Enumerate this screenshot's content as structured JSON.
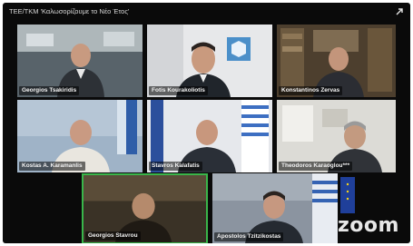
{
  "window": {
    "title": "ΤΕΕ/ΤΚΜ 'Καλωσορίζουμε το Νέο Έτος'"
  },
  "participants": [
    {
      "name": "Georgios Tsakiridis",
      "speaking": false
    },
    {
      "name": "Fotis Kourakoliotis",
      "speaking": false
    },
    {
      "name": "Konstantinos Zervas",
      "speaking": false
    },
    {
      "name": "Kostas A. Karamanlis",
      "speaking": false
    },
    {
      "name": "Stavros Kalafatis",
      "speaking": false
    },
    {
      "name": "Theodoros Karaoglou***",
      "speaking": false
    },
    {
      "name": "Georgios Stavrou",
      "speaking": true
    },
    {
      "name": "Apostolos Tzitzikostas",
      "speaking": false
    }
  ],
  "watermark": "zoom",
  "icons": {
    "fullscreen": "fullscreen-icon"
  },
  "colors": {
    "active_speaker_border": "#39b54a",
    "background": "#0a0a0a"
  }
}
